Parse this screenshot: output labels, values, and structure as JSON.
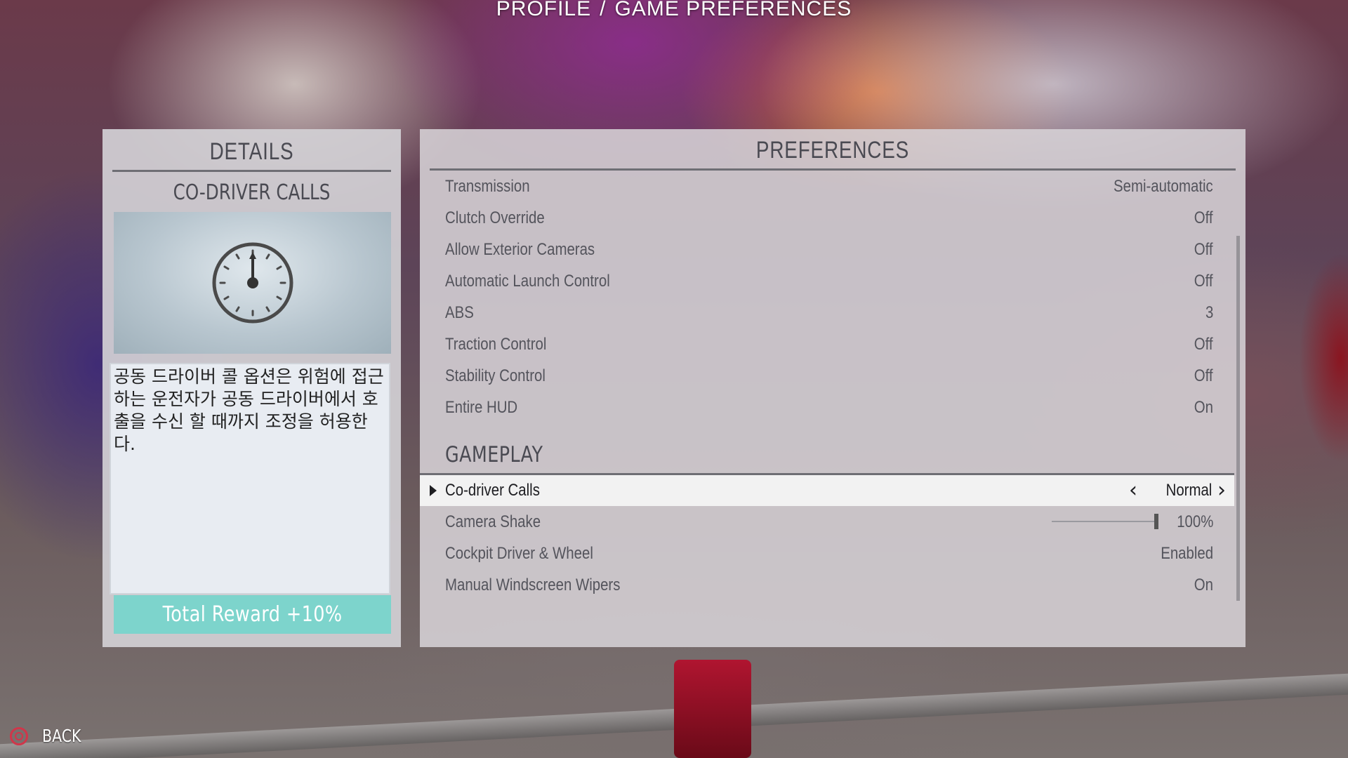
{
  "breadcrumb": {
    "parent": "PROFILE",
    "separator": "/",
    "current": "GAME PREFERENCES"
  },
  "details": {
    "title": "DETAILS",
    "subtitle": "CO-DRIVER CALLS",
    "image_icon": "clock-icon",
    "description": "공동 드라이버 콜 옵션은 위험에 접근하는 운전자가 공동 드라이버에서 호출을 수신 할 때까지 조정을 허용한다.",
    "reward": "Total Reward +10%"
  },
  "preferences": {
    "title": "PREFERENCES",
    "rows": [
      {
        "label": "Transmission",
        "value": "Semi-automatic"
      },
      {
        "label": "Clutch Override",
        "value": "Off"
      },
      {
        "label": "Allow Exterior Cameras",
        "value": "Off"
      },
      {
        "label": "Automatic Launch Control",
        "value": "Off"
      },
      {
        "label": "ABS",
        "value": "3"
      },
      {
        "label": "Traction Control",
        "value": "Off"
      },
      {
        "label": "Stability Control",
        "value": "Off"
      },
      {
        "label": "Entire HUD",
        "value": "On"
      }
    ],
    "section": "GAMEPLAY",
    "selected": {
      "label": "Co-driver Calls",
      "value": "Normal"
    },
    "camera_shake": {
      "label": "Camera Shake",
      "value": "100%",
      "level": 1.0
    },
    "rows2": [
      {
        "label": "Cockpit Driver & Wheel",
        "value": "Enabled"
      },
      {
        "label": "Manual Windscreen Wipers",
        "value": "On"
      }
    ]
  },
  "footer": {
    "back_label": "BACK",
    "back_icon": "circle-button-icon",
    "accent": "#d0364a"
  },
  "colors": {
    "reward_bg": "#7dd4cc",
    "panel_bg": "#d2d0d4",
    "selected_bg": "#f2f2f2"
  }
}
